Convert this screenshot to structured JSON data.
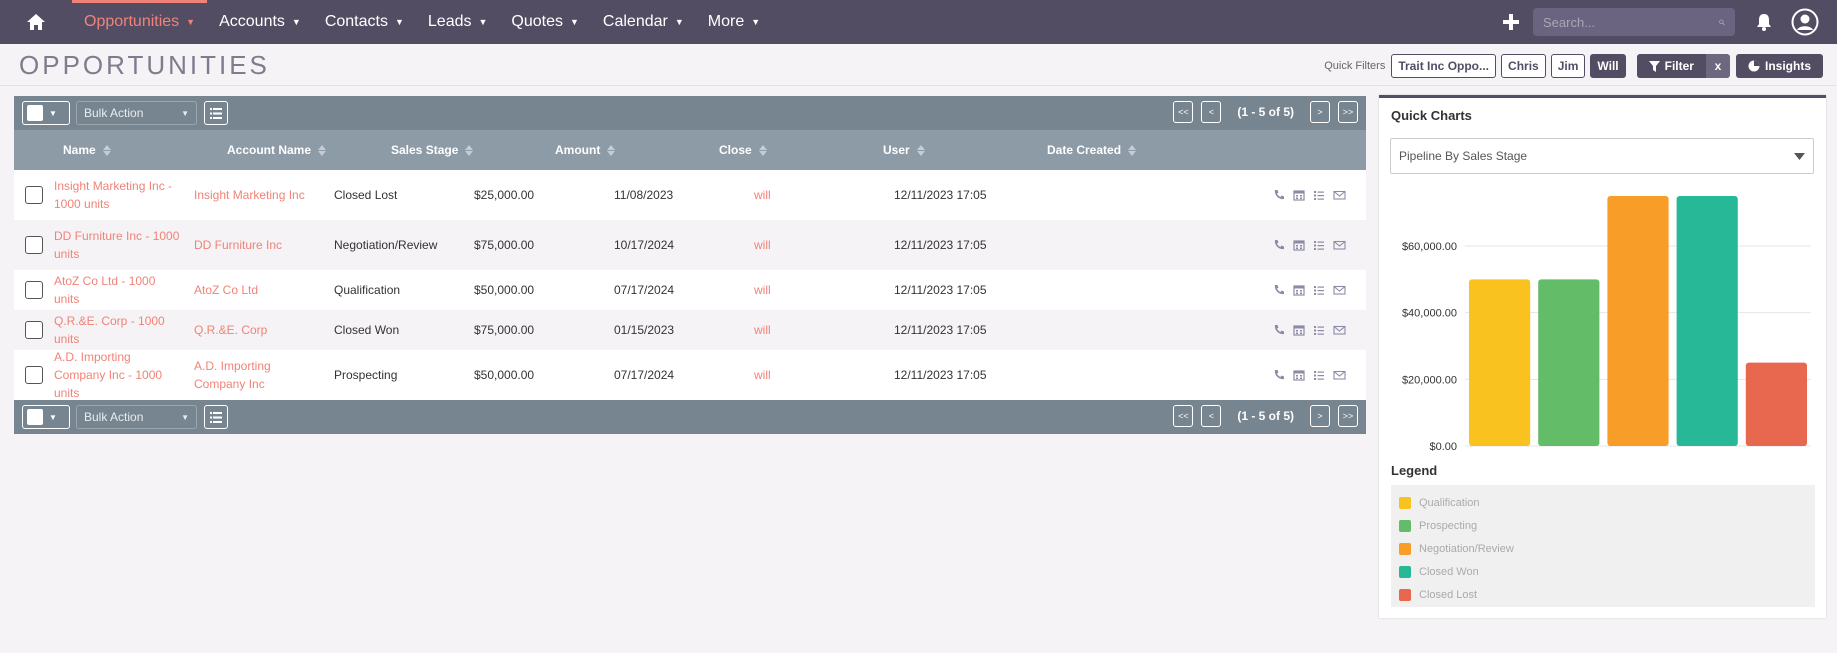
{
  "nav": {
    "items": [
      {
        "label": "Opportunities",
        "active": true
      },
      {
        "label": "Accounts"
      },
      {
        "label": "Contacts"
      },
      {
        "label": "Leads"
      },
      {
        "label": "Quotes"
      },
      {
        "label": "Calendar"
      },
      {
        "label": "More"
      }
    ],
    "search_placeholder": "Search...",
    "colors": {
      "bar": "#534d64",
      "accent": "#f08377"
    }
  },
  "page": {
    "title": "OPPORTUNITIES",
    "quick_filters_label": "Quick Filters",
    "quick_filters": [
      "Trait Inc Oppo...",
      "Chris",
      "Jim",
      "Will"
    ],
    "filter_label": "Filter",
    "filter_clear": "x",
    "insights_label": "Insights"
  },
  "list": {
    "bulk_action": "Bulk Action",
    "pager": {
      "first": "<<",
      "prev": "<",
      "count": "(1 - 5 of 5)",
      "next": ">",
      "last": ">>"
    },
    "columns": [
      "Name",
      "Account Name",
      "Sales Stage",
      "Amount",
      "Close",
      "User",
      "Date Created"
    ],
    "rows": [
      {
        "name": "Insight Marketing Inc - 1000 units",
        "account": "Insight Marketing Inc",
        "stage": "Closed Lost",
        "amount": "$25,000.00",
        "close": "11/08/2023",
        "user": "will",
        "created": "12/11/2023 17:05"
      },
      {
        "name": "DD Furniture Inc - 1000 units",
        "account": "DD Furniture Inc",
        "stage": "Negotiation/Review",
        "amount": "$75,000.00",
        "close": "10/17/2024",
        "user": "will",
        "created": "12/11/2023 17:05"
      },
      {
        "name": "AtoZ Co Ltd - 1000 units",
        "account": "AtoZ Co Ltd",
        "stage": "Qualification",
        "amount": "$50,000.00",
        "close": "07/17/2024",
        "user": "will",
        "created": "12/11/2023 17:05"
      },
      {
        "name": "Q.R.&E. Corp - 1000 units",
        "account": "Q.R.&E. Corp",
        "stage": "Closed Won",
        "amount": "$75,000.00",
        "close": "01/15/2023",
        "user": "will",
        "created": "12/11/2023 17:05"
      },
      {
        "name": "A.D. Importing Company Inc - 1000 units",
        "account": "A.D. Importing Company Inc",
        "stage": "Prospecting",
        "amount": "$50,000.00",
        "close": "07/17/2024",
        "user": "will",
        "created": "12/11/2023 17:05"
      }
    ]
  },
  "charts": {
    "title": "Quick Charts",
    "selected": "Pipeline By Sales Stage",
    "legend_title": "Legend"
  },
  "chart_data": {
    "type": "bar",
    "categories": [
      "Qualification",
      "Prospecting",
      "Negotiation/Review",
      "Closed Won",
      "Closed Lost"
    ],
    "values": [
      50000,
      50000,
      75000,
      75000,
      25000
    ],
    "colors": [
      "#f9c21f",
      "#63bc67",
      "#f89e28",
      "#27b997",
      "#e8674f"
    ],
    "yticks": [
      "$0.00",
      "$20,000.00",
      "$40,000.00",
      "$60,000.00"
    ],
    "ylim": [
      0,
      75000
    ],
    "grid": true,
    "legend": "bottom"
  }
}
